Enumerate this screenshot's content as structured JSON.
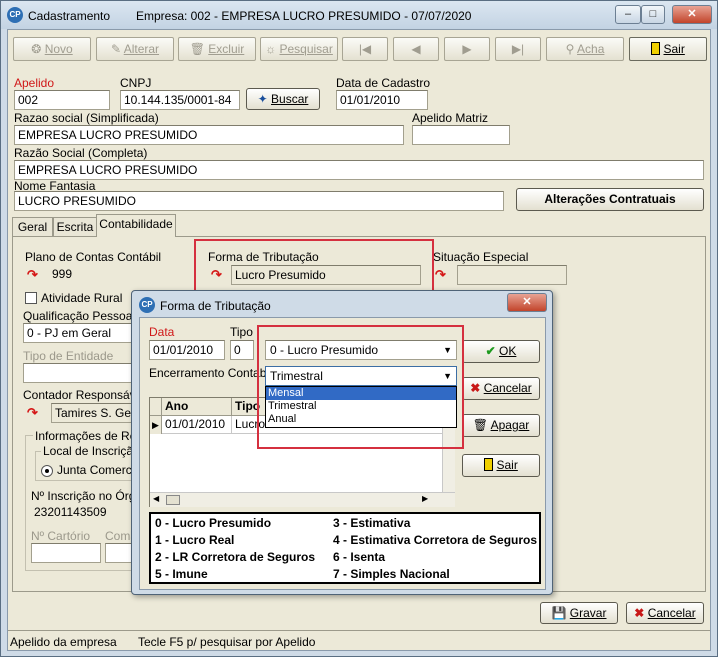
{
  "window": {
    "app_title": "Cadastramento",
    "empresa_title": "Empresa: 002 - EMPRESA LUCRO PRESUMIDO - 07/07/2020"
  },
  "toolbar": {
    "novo": "Novo",
    "alterar": "Alterar",
    "excluir": "Excluir",
    "pesquisar": "Pesquisar",
    "acha": "Acha",
    "sair": "Sair"
  },
  "form": {
    "apelido_label": "Apelido",
    "apelido_value": "002",
    "cnpj_label": "CNPJ",
    "cnpj_value": "10.144.135/0001-84",
    "buscar_label": "Buscar",
    "data_cadastro_label": "Data de Cadastro",
    "data_cadastro_value": "01/01/2010",
    "razao_simplificada_label": "Razao social (Simplificada)",
    "razao_simplificada_value": "EMPRESA LUCRO PRESUMIDO",
    "apelido_matriz_label": "Apelido Matriz",
    "apelido_matriz_value": "",
    "razao_completa_label": "Razão Social (Completa)",
    "razao_completa_value": "EMPRESA LUCRO PRESUMIDO",
    "nome_fantasia_label": "Nome Fantasia",
    "nome_fantasia_value": "LUCRO PRESUMIDO",
    "alteracoes_label": "Alterações Contratuais"
  },
  "tabs": [
    "Geral",
    "Escrita",
    "Contabilidade"
  ],
  "contabilidade": {
    "plano_label": "Plano de Contas Contábil",
    "plano_value": "999",
    "forma_label": "Forma de Tributação",
    "forma_value": "Lucro Presumido",
    "situacao_label": "Situação Especial",
    "situacao_value": "",
    "atividade_rural_label": "Atividade Rural",
    "qualificacao_label": "Qualificação Pessoa Ju",
    "qualificacao_value": "0 - PJ em Geral",
    "tipo_entidade_label": "Tipo de Entidade",
    "contador_label": "Contador Responsável",
    "contador_value": "Tamires S. Geral",
    "info_registro_label": "Informações de Regi",
    "local_inscricao_label": "Local de Inscriçã",
    "junta_comercial_label": "Junta Comercial",
    "num_inscricao_label": "Nº Inscrição no Órgã",
    "num_inscricao_value": "23201143509",
    "num_cartorio_label": "Nº Cartório",
    "comarca_label": "Comar"
  },
  "footer": {
    "gravar": "Gravar",
    "cancelar": "Cancelar",
    "status_left": "Apelido da empresa",
    "status_right": "Tecle F5 p/ pesquisar por Apelido"
  },
  "modal": {
    "title": "Forma de Tributação",
    "data_label": "Data",
    "data_value": "01/01/2010",
    "tipo_label": "Tipo",
    "tipo_value": "0",
    "tipo_select": "0 - Lucro Presumido",
    "encerramento_label": "Encerramento Contabil",
    "encerramento_select": "Trimestral",
    "encerramento_options": [
      "Mensal",
      "Trimestral",
      "Anual"
    ],
    "grid_headers": [
      "Ano",
      "Tipo"
    ],
    "grid_row": {
      "ano": "01/01/2010",
      "tipo": "Lucro Presumido"
    },
    "ok": "OK",
    "cancelar": "Cancelar",
    "apagar": "Apagar",
    "sair": "Sair",
    "legend": [
      "0 - Lucro Presumido",
      "3 - Estimativa",
      "1 - Lucro Real",
      "4 - Estimativa Corretora de Seguros",
      "2 - LR Corretora de Seguros",
      "6 - Isenta",
      "5 - Imune",
      "7 - Simples Nacional"
    ]
  },
  "colors": {
    "highlight_box": "#d5303f",
    "required_label": "#d01818",
    "selection": "#316ac5"
  }
}
